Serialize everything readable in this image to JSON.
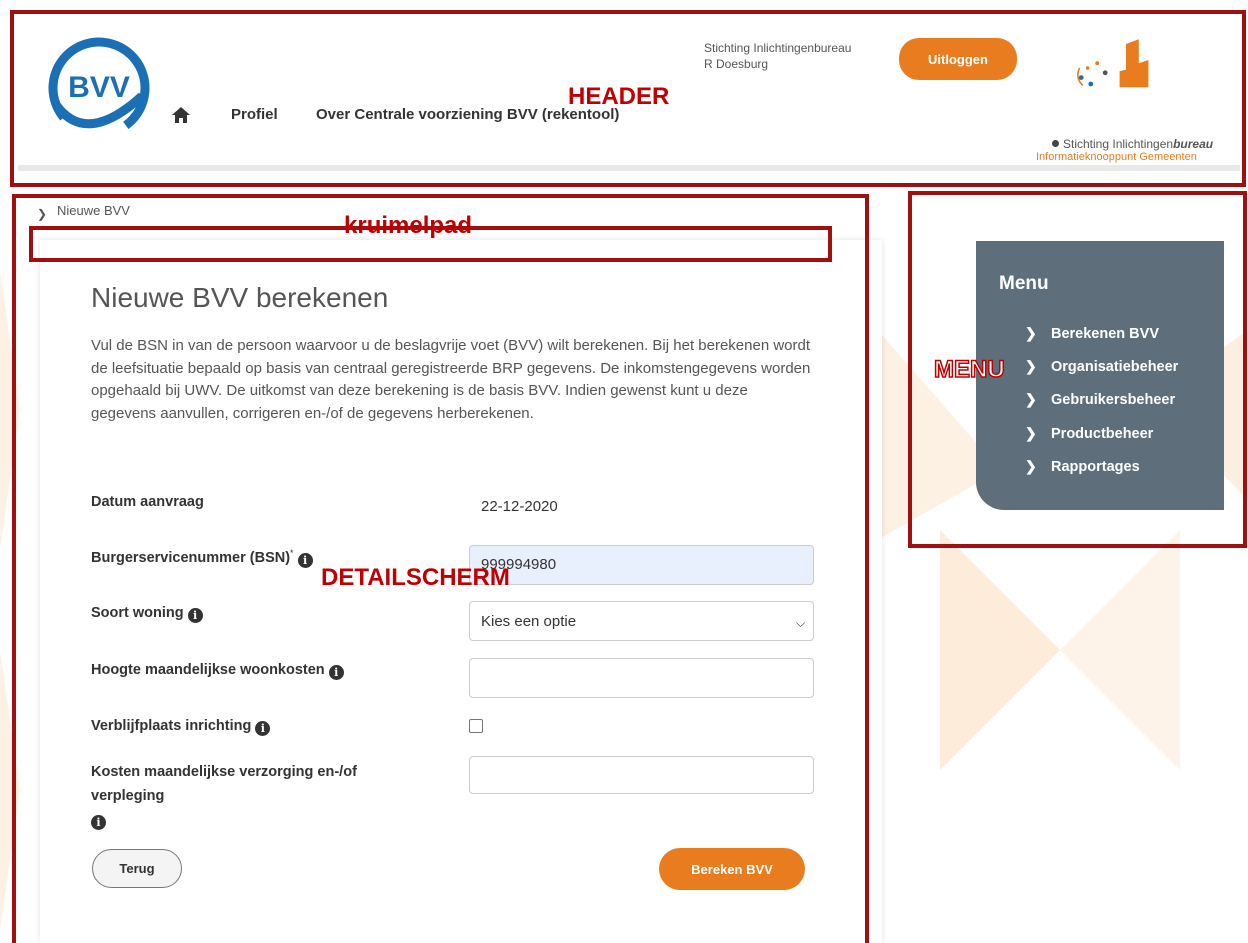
{
  "header": {
    "nav": {
      "profiel": "Profiel",
      "over": "Over Centrale voorziening BVV (rekentool)"
    },
    "user": {
      "org": "Stichting Inlichtingenbureau",
      "name": "R Doesburg"
    },
    "logout_label": "Uitloggen",
    "logo_text": "BVV",
    "sib": {
      "line1_regular": "Stichting Inlichtingen",
      "line1_bold": "bureau",
      "line2": "Informatieknooppunt Gemeenten"
    }
  },
  "annotations": {
    "header": "HEADER",
    "breadcrumb": "kruimelpad",
    "menu": "MENU",
    "detail": "DETAILSCHERM"
  },
  "breadcrumb": {
    "current": "Nieuwe BVV"
  },
  "detail": {
    "title": "Nieuwe BVV berekenen",
    "intro": "Vul de BSN in van de persoon waarvoor u de beslagvrije voet (BVV) wilt berekenen. Bij het berekenen wordt de leefsituatie bepaald op basis van centraal geregistreerde BRP gegevens. De inkomstengegevens worden opgehaald bij UWV. De uitkomst van deze berekening is de basis BVV. Indien gewenst kunt u deze gegevens aanvullen, corrigeren en-/of de gegevens herberekenen.",
    "fields": {
      "datum_label": "Datum aanvraag",
      "datum_value": "22-12-2020",
      "bsn_label": "Burgerservicenummer (BSN)",
      "bsn_required": "*",
      "bsn_value": "999994980",
      "woning_label": "Soort woning",
      "woning_value": "Kies een optie",
      "woonkosten_label": "Hoogte maandelijkse woonkosten",
      "woonkosten_value": "",
      "inrichting_label": "Verblijfplaats inrichting",
      "inrichting_checked": false,
      "verzorging_label_1": "Kosten maandelijkse verzorging en-/of",
      "verzorging_label_2": "verpleging",
      "verzorging_value": ""
    },
    "back_label": "Terug",
    "submit_label": "Bereken BVV"
  },
  "menu": {
    "title": "Menu",
    "items": [
      "Berekenen BVV",
      "Organisatiebeheer",
      "Gebruikersbeheer",
      "Productbeheer",
      "Rapportages"
    ]
  },
  "colors": {
    "accent": "#e87c1e",
    "menu_bg": "#5e6e7a",
    "bvv_blue": "#1a6fb5",
    "annotation": "#a01010"
  },
  "icons": [
    "home-icon",
    "info-icon",
    "chevron-right-icon",
    "chevron-down-icon"
  ]
}
